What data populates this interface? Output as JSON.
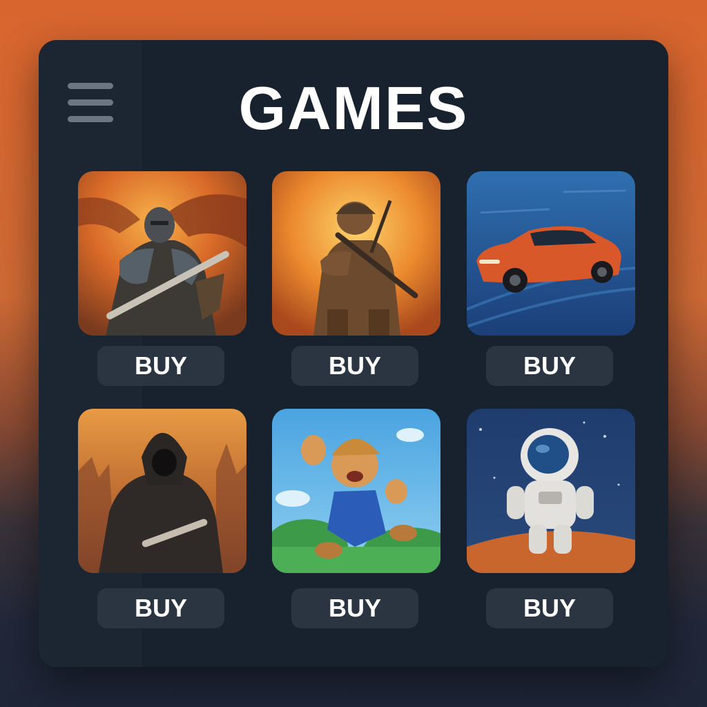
{
  "header": {
    "title": "GAMES",
    "menu_icon": "hamburger-menu-icon"
  },
  "colors": {
    "panel": "#18222e",
    "button": "#2a3541",
    "accent": "#d9652e"
  },
  "games": [
    {
      "art": "armored-knight-with-sword-art",
      "buy_label": "BUY"
    },
    {
      "art": "soldier-with-rifle-art",
      "buy_label": "BUY"
    },
    {
      "art": "red-sports-car-art",
      "buy_label": "BUY"
    },
    {
      "art": "hooded-assassin-art",
      "buy_label": "BUY"
    },
    {
      "art": "jumping-plumber-art",
      "buy_label": "BUY"
    },
    {
      "art": "astronaut-on-planet-art",
      "buy_label": "BUY"
    }
  ]
}
